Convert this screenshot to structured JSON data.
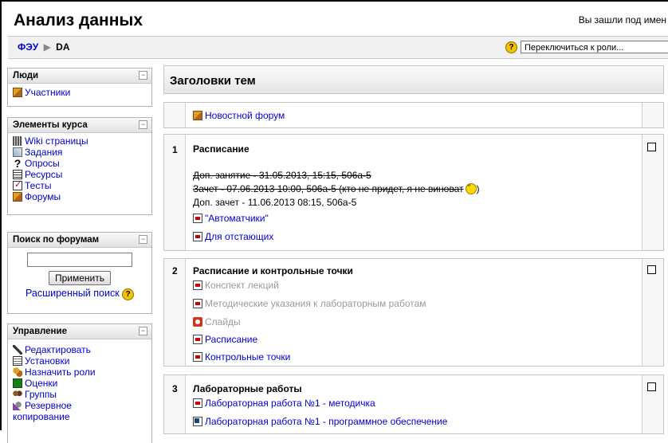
{
  "header": {
    "site_title": "Анализ данных",
    "login_info": "Вы зашли под имен"
  },
  "navbar": {
    "breadcrumb_home": "ФЭУ",
    "breadcrumb_separator": "▶",
    "breadcrumb_current": "DA",
    "help_glyph": "?",
    "role_switch": "Переключиться к роли..."
  },
  "blocks": {
    "people": {
      "title": "Люди",
      "collapse": "−",
      "items": [
        {
          "label": "Участники",
          "icon": "participants-icon"
        }
      ]
    },
    "activities": {
      "title": "Элементы курса",
      "collapse": "−",
      "items": [
        {
          "label": "Wiki страницы",
          "icon": "wiki-icon"
        },
        {
          "label": "Задания",
          "icon": "assignment-icon"
        },
        {
          "label": "Опросы",
          "icon": "question-icon"
        },
        {
          "label": "Ресурсы",
          "icon": "resource-icon"
        },
        {
          "label": "Тесты",
          "icon": "quiz-icon"
        },
        {
          "label": "Форумы",
          "icon": "forum-icon"
        }
      ]
    },
    "forum_search": {
      "title": "Поиск по форумам",
      "collapse": "−",
      "input_value": "",
      "apply_label": "Применить",
      "advanced_label": "Расширенный поиск"
    },
    "admin": {
      "title": "Управление",
      "collapse": "−",
      "items": [
        {
          "label": "Редактировать",
          "icon": "edit-icon"
        },
        {
          "label": "Установки",
          "icon": "settings-icon"
        },
        {
          "label": "Назначить роли",
          "icon": "roles-icon"
        },
        {
          "label": "Оценки",
          "icon": "grades-icon"
        },
        {
          "label": "Группы",
          "icon": "groups-icon"
        },
        {
          "label": "Резервное",
          "icon": "backup-icon"
        },
        {
          "label": "копирование",
          "icon": ""
        }
      ]
    }
  },
  "main": {
    "header_title": "Заголовки тем",
    "news_forum": "Новостной форум",
    "sections": [
      {
        "number": "1",
        "title": "Расписание",
        "strike_1": "Доп. занятие - 31.05.2013, 15:15, 506а-5",
        "strike_2": "Зачет - 07.06.2013 10:00, 506а-5 (кто не придет, я не виноват",
        "strike_2_end": ")",
        "note": "Доп. зачет - 11.06.2013 08:15, 506а-5",
        "links": [
          "\"Автоматчики\"",
          "Для отстающих"
        ]
      },
      {
        "number": "2",
        "title": "Расписание и контрольные точки",
        "links": [
          "Конспект лекций",
          "Методические указания к лабораторным работам",
          "Слайды",
          "Расписание",
          "Контрольные точки"
        ]
      },
      {
        "number": "3",
        "title": "Лабораторные работы",
        "links": [
          "Лабораторная работа №1 - методичка",
          "Лабораторная работа №1 - программное обеспечение"
        ]
      }
    ]
  }
}
